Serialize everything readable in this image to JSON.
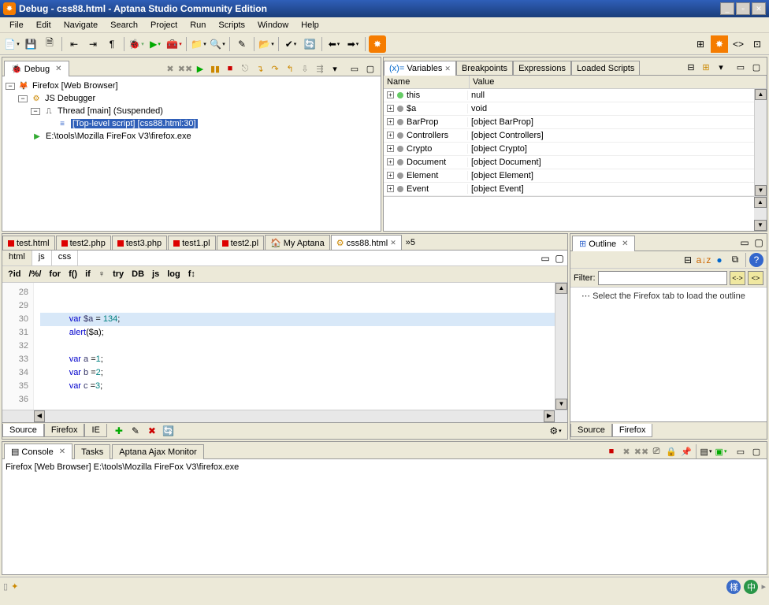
{
  "window": {
    "title": "Debug - css88.html - Aptana Studio Community Edition"
  },
  "menu": [
    "File",
    "Edit",
    "Navigate",
    "Search",
    "Project",
    "Run",
    "Scripts",
    "Window",
    "Help"
  ],
  "debug": {
    "tab": "Debug",
    "tree": {
      "root": "Firefox [Web Browser]",
      "debugger": "JS Debugger",
      "thread": "Thread [main] (Suspended)",
      "script": "[Top-level script] [css88.html:30]",
      "exe": "E:\\tools\\Mozilla FireFox V3\\firefox.exe"
    }
  },
  "variables": {
    "tabs": [
      "Variables",
      "Breakpoints",
      "Expressions",
      "Loaded Scripts"
    ],
    "headers": {
      "name": "Name",
      "value": "Value"
    },
    "rows": [
      {
        "name": "this",
        "value": "null",
        "color": "#6c6"
      },
      {
        "name": "$a",
        "value": "void",
        "color": "#999"
      },
      {
        "name": "BarProp",
        "value": "[object BarProp]",
        "color": "#999"
      },
      {
        "name": "Controllers",
        "value": "[object Controllers]",
        "color": "#999"
      },
      {
        "name": "Crypto",
        "value": "[object Crypto]",
        "color": "#999"
      },
      {
        "name": "Document",
        "value": "[object Document]",
        "color": "#999"
      },
      {
        "name": "Element",
        "value": "[object Element]",
        "color": "#999"
      },
      {
        "name": "Event",
        "value": "[object Event]",
        "color": "#999"
      }
    ]
  },
  "editor": {
    "tabs": [
      {
        "label": "test.html",
        "icon": "dot"
      },
      {
        "label": "test2.php",
        "icon": "dot"
      },
      {
        "label": "test3.php",
        "icon": "dot"
      },
      {
        "label": "test1.pl",
        "icon": "dot"
      },
      {
        "label": "test2.pl",
        "icon": "dot"
      },
      {
        "label": "My Aptana",
        "icon": "home"
      },
      {
        "label": "css88.html",
        "icon": "js",
        "active": true,
        "close": true
      }
    ],
    "overflow": "»5",
    "sub_tabs": [
      "html",
      "js",
      "css"
    ],
    "snippets": [
      "?id",
      "/%/",
      "for",
      "f()",
      "if",
      "♀",
      "try",
      "DB",
      "js",
      "log",
      "f↕"
    ],
    "lines": [
      {
        "n": 28,
        "t": ""
      },
      {
        "n": 29,
        "t": ""
      },
      {
        "n": 30,
        "t": "            var $a = 134;",
        "hl": true
      },
      {
        "n": 31,
        "t": "            alert($a);"
      },
      {
        "n": 32,
        "t": ""
      },
      {
        "n": 33,
        "t": "            var a =1;"
      },
      {
        "n": 34,
        "t": "            var b =2;"
      },
      {
        "n": 35,
        "t": "            var c =3;"
      },
      {
        "n": 36,
        "t": ""
      }
    ],
    "bottom_tabs": [
      "Source",
      "Firefox",
      "IE"
    ]
  },
  "outline": {
    "tab": "Outline",
    "filter_label": "Filter:",
    "message": "Select the Firefox tab to load the outline",
    "bottom_tabs": [
      "Source",
      "Firefox"
    ]
  },
  "console": {
    "tabs": [
      "Console",
      "Tasks",
      "Aptana Ajax Monitor"
    ],
    "text": "Firefox [Web Browser] E:\\tools\\Mozilla FireFox V3\\firefox.exe"
  },
  "status": {
    "left_icon": "▯*"
  }
}
